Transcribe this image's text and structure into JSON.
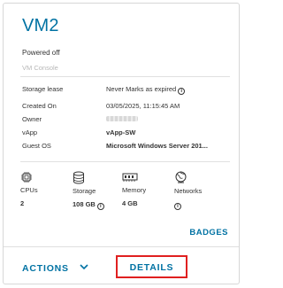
{
  "vm": {
    "name": "VM2",
    "status": "Powered off",
    "console_label": "VM Console"
  },
  "details": {
    "storage_lease": {
      "label": "Storage lease",
      "value": "Never Marks as expired"
    },
    "created_on": {
      "label": "Created On",
      "value": "03/05/2025, 11:15:45 AM"
    },
    "owner": {
      "label": "Owner"
    },
    "vapp": {
      "label": "vApp",
      "value": "vApp-SW"
    },
    "guest_os": {
      "label": "Guest OS",
      "value": "Microsoft Windows Server 201..."
    }
  },
  "resources": {
    "cpus": {
      "label": "CPUs",
      "value": "2",
      "icon": "cpu-icon"
    },
    "storage": {
      "label": "Storage",
      "value": "108 GB",
      "icon": "storage-icon"
    },
    "memory": {
      "label": "Memory",
      "value": "4 GB",
      "icon": "memory-icon"
    },
    "networks": {
      "label": "Networks",
      "icon": "network-icon"
    }
  },
  "footer": {
    "badges_label": "BADGES",
    "actions_label": "ACTIONS",
    "details_label": "DETAILS"
  },
  "colors": {
    "accent": "#0072a3",
    "highlight_border": "#e02020"
  }
}
